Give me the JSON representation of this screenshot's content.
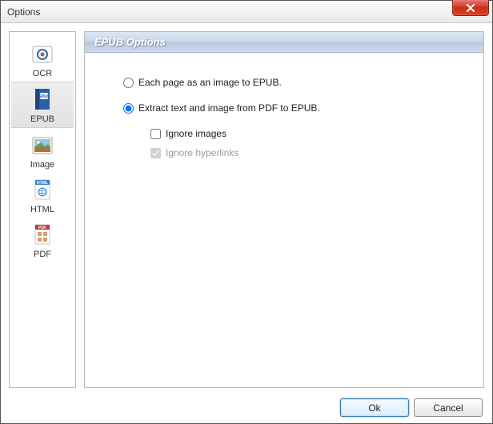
{
  "window": {
    "title": "Options"
  },
  "sidebar": {
    "items": [
      {
        "label": "OCR"
      },
      {
        "label": "EPUB"
      },
      {
        "label": "Image"
      },
      {
        "label": "HTML"
      },
      {
        "label": "PDF"
      }
    ]
  },
  "panel": {
    "header": "EPUB Options",
    "opt1": "Each page as an image to EPUB.",
    "opt2": "Extract text and image from PDF to EPUB.",
    "ignore_images": "Ignore images",
    "ignore_hyperlinks": "Ignore hyperlinks"
  },
  "buttons": {
    "ok": "Ok",
    "cancel": "Cancel"
  }
}
